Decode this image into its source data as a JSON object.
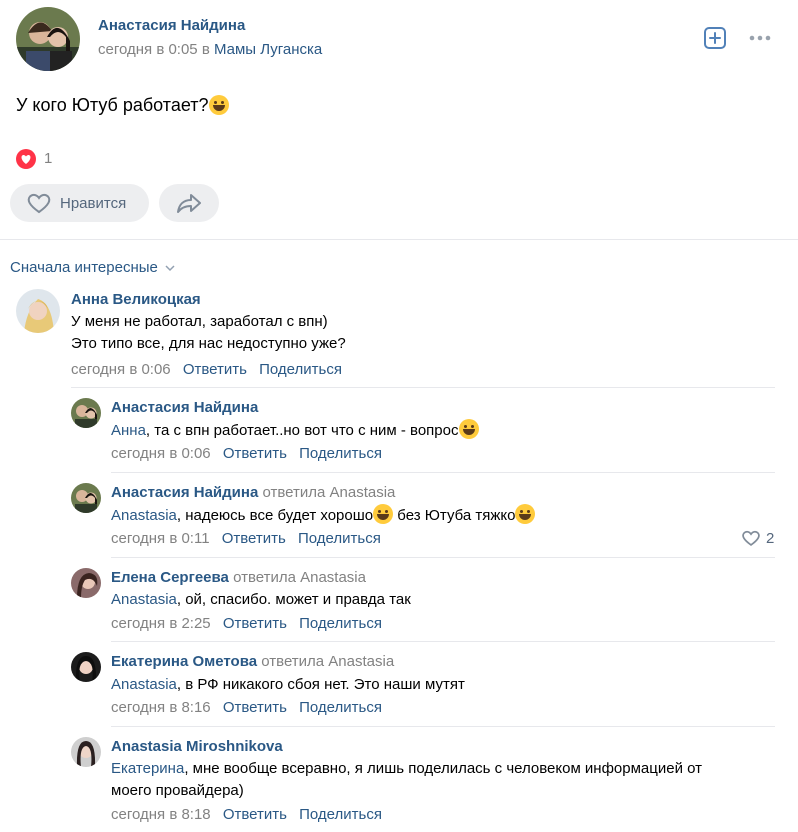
{
  "post": {
    "author": "Анастасия Найдина",
    "time": "сегодня в 0:05",
    "in_word": "в",
    "group": "Мамы Луганска",
    "text": "У кого Ютуб работает?",
    "reactions_count": "1",
    "like_label": "Нравится"
  },
  "comments_header": {
    "sort_label": "Сначала интересные"
  },
  "actions": {
    "reply": "Ответить",
    "share": "Поделиться"
  },
  "comment": {
    "author": "Анна Великоцкая",
    "line1": "У меня не работал, заработал с впн)",
    "line2": "Это типо все, для нас недоступно уже?",
    "time": "сегодня в 0:06"
  },
  "replies": [
    {
      "author": "Анастасия Найдина",
      "replied_to": "",
      "mention": "Анна",
      "text": ", та с впн работает..но вот что с ним - вопрос",
      "time": "сегодня в 0:06",
      "likes": ""
    },
    {
      "author": "Анастасия Найдина",
      "replied_to": "ответила Anastasia",
      "mention": "Anastasia",
      "text": ", надеюсь все будет хорошо",
      "text2": " без Ютуба тяжко",
      "time": "сегодня в 0:11",
      "likes": "2"
    },
    {
      "author": "Елена Сергеева",
      "replied_to": "ответила Anastasia",
      "mention": "Anastasia",
      "text": ", ой, спасибо. может и правда так",
      "time": "сегодня в 2:25",
      "likes": ""
    },
    {
      "author": "Екатерина Ометова",
      "replied_to": "ответила Anastasia",
      "mention": "Anastasia",
      "text": ", в РФ никакого сбоя нет. Это наши мутят",
      "time": "сегодня в 8:16",
      "likes": ""
    },
    {
      "author": "Anastasia Miroshnikova",
      "replied_to": "",
      "mention": "Екатерина",
      "text": ", мне вообще всеравно, я лишь поделилась с человеком информацией от",
      "text_line2": "моего провайдера)",
      "time": "сегодня в 8:18",
      "likes": ""
    }
  ],
  "colors": {
    "link": "#2a5885",
    "muted": "#828282",
    "heart": "#ff3347",
    "button_bg": "#edeef0"
  }
}
